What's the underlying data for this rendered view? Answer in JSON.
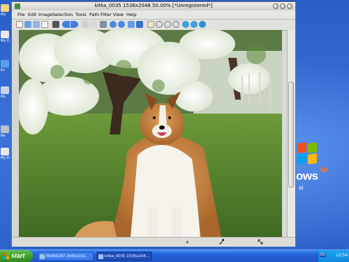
{
  "window": {
    "title": "kitka_0035 1536x2048 50.00% [*Unregistered*]"
  },
  "menu": [
    "File",
    "Edit",
    "Image",
    "Selection",
    "Tools",
    "Path",
    "Filter",
    "View",
    "Help"
  ],
  "desktop": {
    "icon_labels": [
      "My",
      "My D",
      "Ex",
      "My",
      "Re",
      "My D"
    ],
    "xp_word": "ows",
    "xp_sup": "xp",
    "xp_sub": "al"
  },
  "taskbar": {
    "start_label": "start",
    "tasks": [
      "P6060287 2560x192...",
      "kitka_0035 1536x204..."
    ],
    "lang": "EN",
    "clock": "12:54"
  },
  "statusbar": {
    "icons": [
      "+",
      "eyedropper-icon",
      "resize-icon"
    ]
  },
  "colors": {
    "desktop_blue": "#2f62c8",
    "taskbar_blue": "#245edb",
    "start_green": "#3a9a2a",
    "window_gray": "#d9d9d6"
  }
}
